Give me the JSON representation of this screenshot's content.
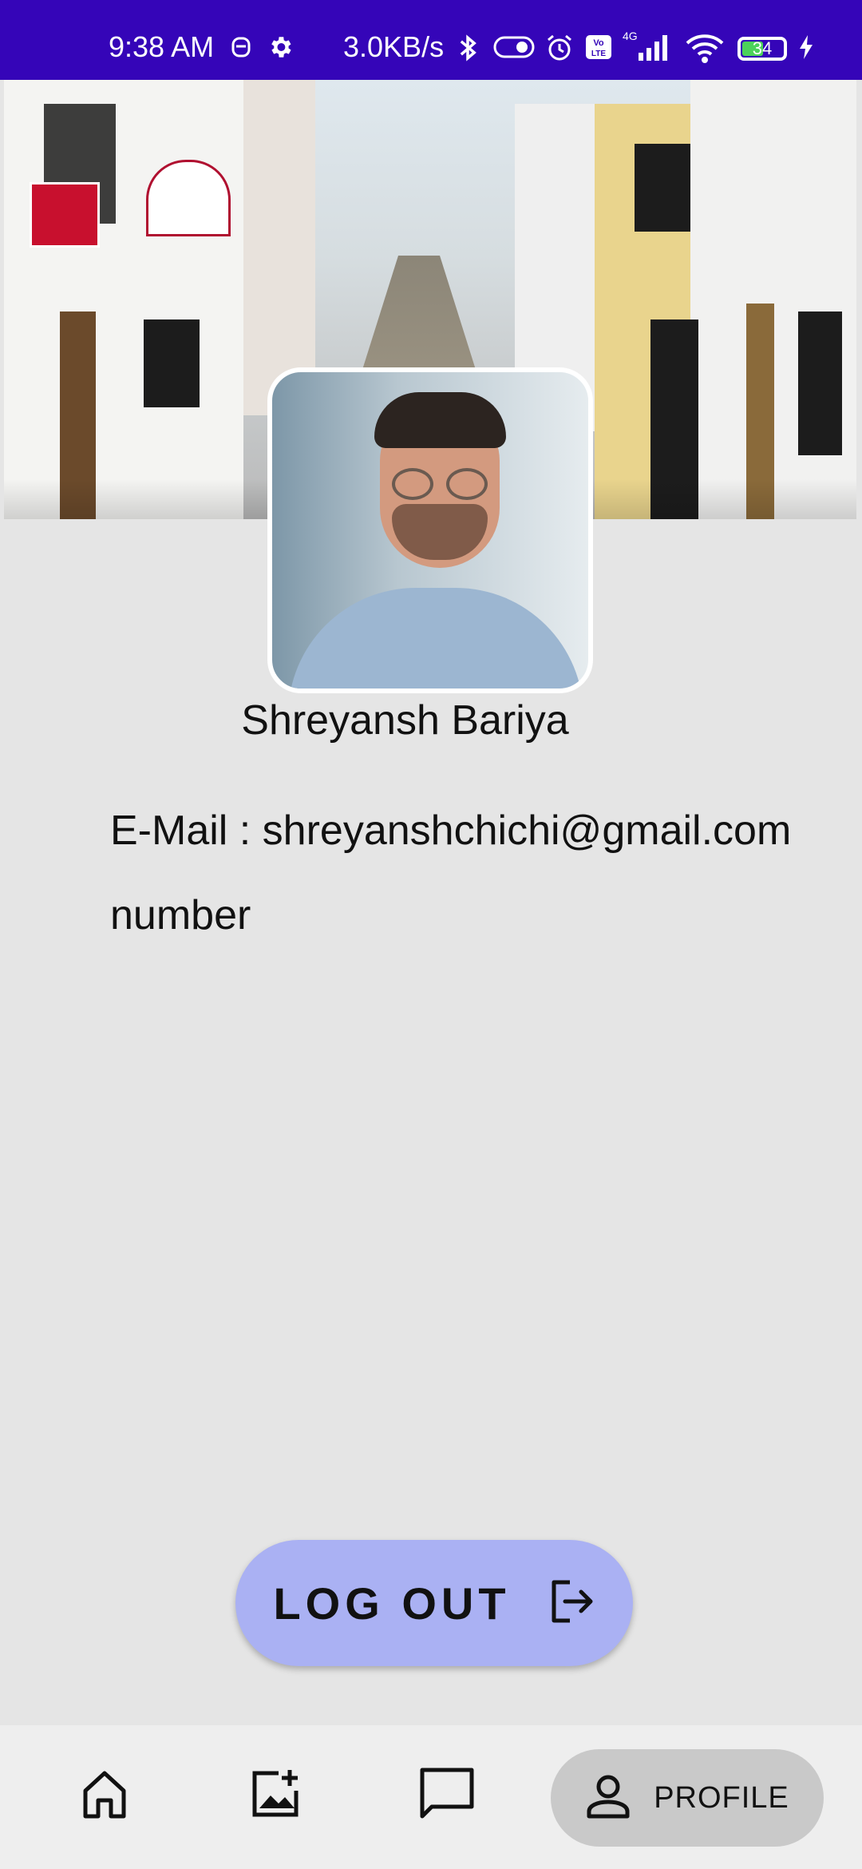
{
  "status_bar": {
    "time": "9:38 AM",
    "network_speed": "3.0KB/s",
    "battery_level": "34",
    "network_type": "4G",
    "icons": [
      "alarm-silhouette-icon",
      "settings-icon",
      "bluetooth-icon",
      "toggle-icon",
      "alarm-icon",
      "volte-icon",
      "signal-icon",
      "wifi-icon",
      "battery-icon",
      "charging-icon"
    ]
  },
  "profile": {
    "name": "Shreyansh Bariya",
    "email_line": "E-Mail : shreyanshchichi@gmail.com",
    "number_line": "number"
  },
  "actions": {
    "logout_label": "LOG OUT",
    "logout_icon": "logout-icon"
  },
  "bottom_nav": {
    "items": [
      {
        "icon": "home-icon"
      },
      {
        "icon": "add-image-icon"
      },
      {
        "icon": "chat-icon"
      },
      {
        "icon": "profile-icon",
        "label": "PROFILE",
        "selected": true
      }
    ]
  },
  "colors": {
    "status_bar": "#3505b8",
    "background": "#e5e5e5",
    "logout_button": "#aab1f3",
    "nav_selected": "#c9c9c9"
  }
}
